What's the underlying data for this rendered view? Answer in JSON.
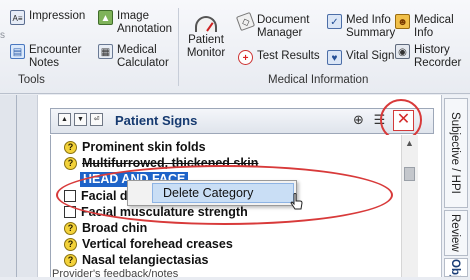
{
  "ribbon": {
    "tools_group": {
      "label": "Tools",
      "items": [
        {
          "label": "Impression"
        },
        {
          "label": "Image\nAnnotation"
        },
        {
          "label": "Encounter\nNotes"
        },
        {
          "label": "Medical\nCalculator"
        }
      ]
    },
    "medical_info_group": {
      "label": "Medical Information",
      "items": [
        {
          "label": "Patient\nMonitor"
        },
        {
          "label": "Document\nManager"
        },
        {
          "label": "Test Results"
        },
        {
          "label": "Med Info\nSummary"
        },
        {
          "label": "Vital Sign"
        },
        {
          "label": "Medical\nInfo"
        },
        {
          "label": "History\nRecorder"
        }
      ]
    }
  },
  "panel": {
    "title": "Patient Signs",
    "category_label": "HEAD AND FACE"
  },
  "list_items": [
    {
      "label": "Prominent skin folds",
      "icon": "question-icon",
      "strike": false
    },
    {
      "label": "Multifurrowed, thickened skin",
      "icon": "question-icon",
      "strike": true
    },
    {
      "label": "Facial diaphoresis",
      "icon": "checkbox",
      "strike": false
    },
    {
      "label": "Facial musculature strength",
      "icon": "checkbox",
      "strike": false
    },
    {
      "label": "Broad chin",
      "icon": "question-icon",
      "strike": false
    },
    {
      "label": "Vertical forehead creases",
      "icon": "question-icon",
      "strike": false
    },
    {
      "label": "Nasal telangiectasias",
      "icon": "question-icon",
      "strike": false
    }
  ],
  "context_menu": {
    "item": "Delete Category"
  },
  "right_tabs": [
    {
      "label": "Subjective / HPI"
    },
    {
      "label": "Review"
    },
    {
      "label": "Objective"
    }
  ],
  "footer": {
    "text": "Provider's feedback/notes"
  },
  "colors": {
    "selection": "#1e63c8",
    "highlight_ring": "#d83a3a",
    "title": "#163a70"
  }
}
